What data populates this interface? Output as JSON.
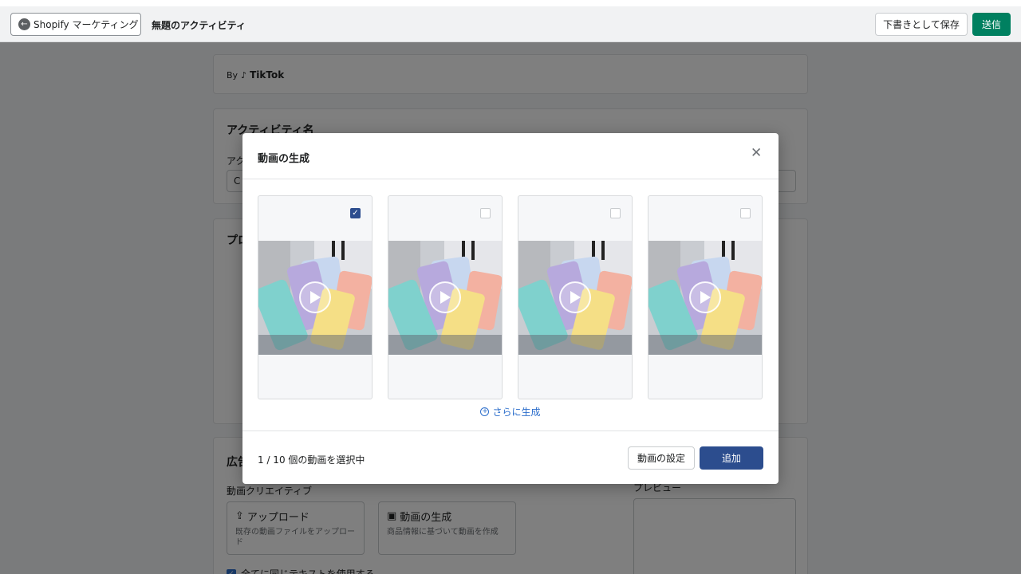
{
  "topbar": {
    "back_label": "Shopify マーケティング",
    "title": "無題のアクティビティ",
    "save_draft": "下書きとして保存",
    "send": "送信"
  },
  "background": {
    "by_label": "By",
    "brand": "TikTok",
    "activity_name_title": "アクティビティ名",
    "activity_name_label": "アク",
    "activity_name_value": "C",
    "product_title": "プロ",
    "ad_title": "広告",
    "video_creative_label": "動画クリエイティブ",
    "upload_title": "アップロード",
    "upload_desc": "既存の動画ファイルをアップロード",
    "generate_title": "動画の生成",
    "generate_desc": "商品情報に基づいて動画を作成",
    "preview_label": "プレビュー",
    "same_text_label": "全てに同じテキストを使用する"
  },
  "modal": {
    "title": "動画の生成",
    "close_icon": "close-icon",
    "videos": [
      {
        "selected": true
      },
      {
        "selected": false
      },
      {
        "selected": false
      },
      {
        "selected": false
      }
    ],
    "generate_more": "さらに生成",
    "selection_count": "1 / 10 個の動画を選択中",
    "video_settings": "動画の設定",
    "add": "追加"
  },
  "colors": {
    "primary_green": "#008060",
    "primary_blue": "#2c4d8e",
    "link_blue": "#2c6ecb"
  }
}
